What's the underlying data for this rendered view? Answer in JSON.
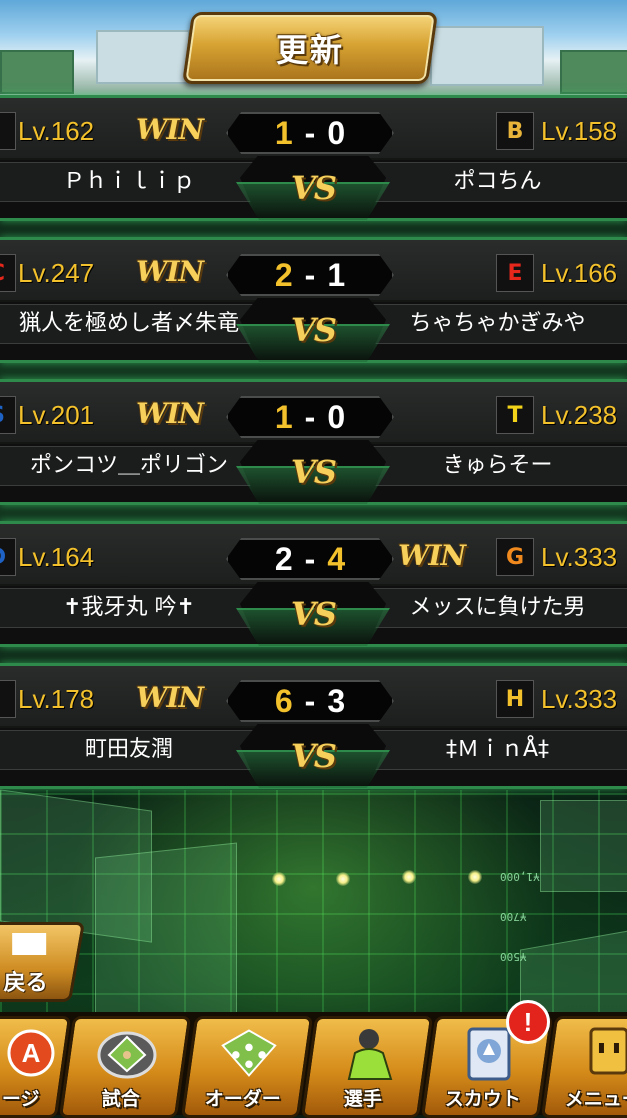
{
  "update_button": {
    "label": "更新"
  },
  "matches": [
    {
      "left": {
        "icon": "orange-team-icon",
        "icon_glyph": "",
        "level": "Lv.162",
        "name": "Ｐｈｉｌｉｐ",
        "win": true
      },
      "right": {
        "icon": "b-team-icon",
        "icon_glyph": "B",
        "level": "Lv.158",
        "name": "ポコちん",
        "win": false
      },
      "score_left": "1",
      "score_dash": "-",
      "score_right": "0",
      "vs": "VS",
      "win_label": "WIN"
    },
    {
      "left": {
        "icon": "red-c-team-icon",
        "icon_glyph": "C",
        "level": "Lv.247",
        "name": "猟人を極めし者〆朱竜",
        "win": true
      },
      "right": {
        "icon": "eagles-team-icon",
        "icon_glyph": "E",
        "level": "Lv.166",
        "name": "ちゃちゃかぎみや",
        "win": false
      },
      "score_left": "2",
      "score_dash": "-",
      "score_right": "1",
      "vs": "VS",
      "win_label": "WIN"
    },
    {
      "left": {
        "icon": "blue-team-icon",
        "icon_glyph": "S",
        "level": "Lv.201",
        "name": "ポンコツ＿ポリゴン",
        "win": true
      },
      "right": {
        "icon": "tigers-team-icon",
        "icon_glyph": "T",
        "level": "Lv.238",
        "name": "きゅらそー",
        "win": false
      },
      "score_left": "1",
      "score_dash": "-",
      "score_right": "0",
      "vs": "VS",
      "win_label": "WIN"
    },
    {
      "left": {
        "icon": "blue-d-team-icon",
        "icon_glyph": "D",
        "level": "Lv.164",
        "name": "✝我牙丸 吟✝",
        "win": false
      },
      "right": {
        "icon": "giants-team-icon",
        "icon_glyph": "G",
        "level": "Lv.333",
        "name": "メッスに負けた男",
        "win": true
      },
      "score_left": "2",
      "score_dash": "-",
      "score_right": "4",
      "vs": "VS",
      "win_label": "WIN"
    },
    {
      "left": {
        "icon": "orange-team-icon",
        "icon_glyph": "",
        "level": "Lv.178",
        "name": "町田友潤",
        "win": true
      },
      "right": {
        "icon": "hawks-team-icon",
        "icon_glyph": "H",
        "level": "Lv.333",
        "name": "‡ＭｉｎÅ‡",
        "win": false
      },
      "score_left": "6",
      "score_dash": "-",
      "score_right": "3",
      "vs": "VS",
      "win_label": "WIN"
    }
  ],
  "field_texts": [
    "¥1,000",
    "¥700",
    "¥500"
  ],
  "back_button": {
    "label": "戻る"
  },
  "nav": [
    {
      "label": "ージ",
      "icon": "home-icon"
    },
    {
      "label": "試合",
      "icon": "baseball-field-icon"
    },
    {
      "label": "オーダー",
      "icon": "order-field-icon"
    },
    {
      "label": "選手",
      "icon": "player-icon"
    },
    {
      "label": "スカウト",
      "icon": "scout-card-icon"
    },
    {
      "label": "メニュー",
      "icon": "menu-character-icon"
    }
  ],
  "notification_badge": "!",
  "colors": {
    "win": "#f3c12b",
    "accent_green": "#2d8a4a",
    "badge_red": "#e3241c"
  }
}
